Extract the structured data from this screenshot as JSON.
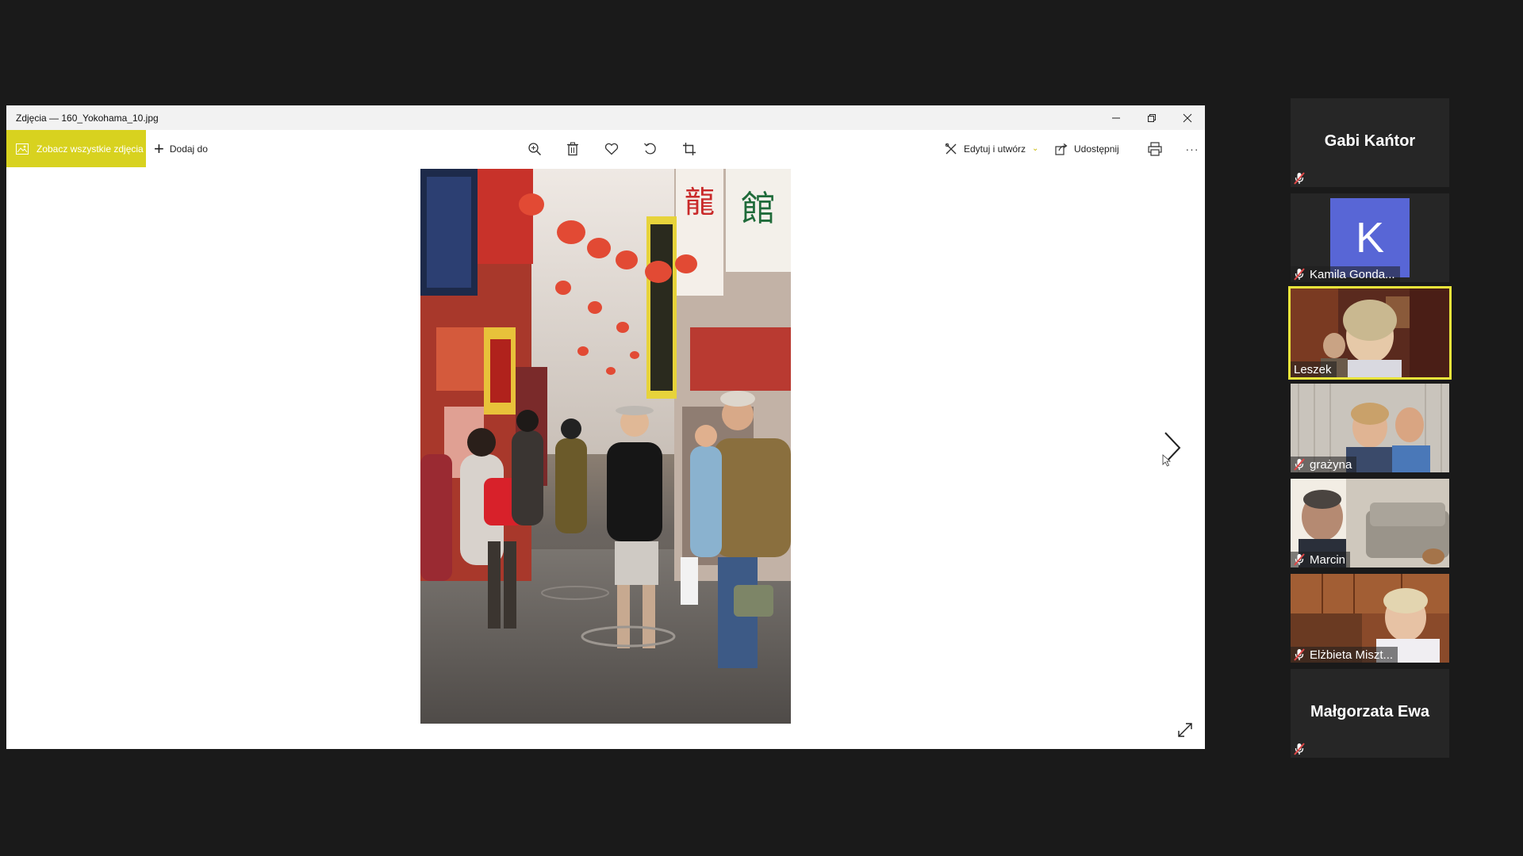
{
  "window": {
    "title": "Zdjęcia — 160_Yokohama_10.jpg",
    "controls": {
      "minimize": "—",
      "restore": "❐",
      "close": "✕"
    }
  },
  "toolbar": {
    "see_all_label": "Zobacz wszystkie zdjęcia",
    "add_to_label": "Dodaj do",
    "edit_create_label": "Edytuj i utwórz",
    "share_label": "Udostępnij",
    "more_label": "···",
    "icons": [
      "zoom-icon",
      "delete-icon",
      "favorite-icon",
      "rotate-icon",
      "crop-icon",
      "print-icon"
    ],
    "accent_color": "#d8d21f"
  },
  "photo": {
    "filename": "160_Yokohama_10.jpg"
  },
  "participants": [
    {
      "name": "Gabi Kańtor",
      "muted": true,
      "kind": "name"
    },
    {
      "name": "Kamila Gonda...",
      "muted": true,
      "kind": "avatar",
      "avatar_letter": "K",
      "avatar_color": "#5866d6"
    },
    {
      "name": "Leszek",
      "muted": false,
      "kind": "video",
      "active_speaker": true
    },
    {
      "name": "grażyna",
      "muted": true,
      "kind": "video"
    },
    {
      "name": "Marcin",
      "muted": true,
      "kind": "video"
    },
    {
      "name": "Elżbieta Miszt...",
      "muted": true,
      "kind": "video"
    },
    {
      "name": "Małgorzata Ewa",
      "muted": true,
      "kind": "name"
    }
  ],
  "colors": {
    "active_speaker_border": "#e9e43a",
    "muted_icon": "#e04848"
  }
}
